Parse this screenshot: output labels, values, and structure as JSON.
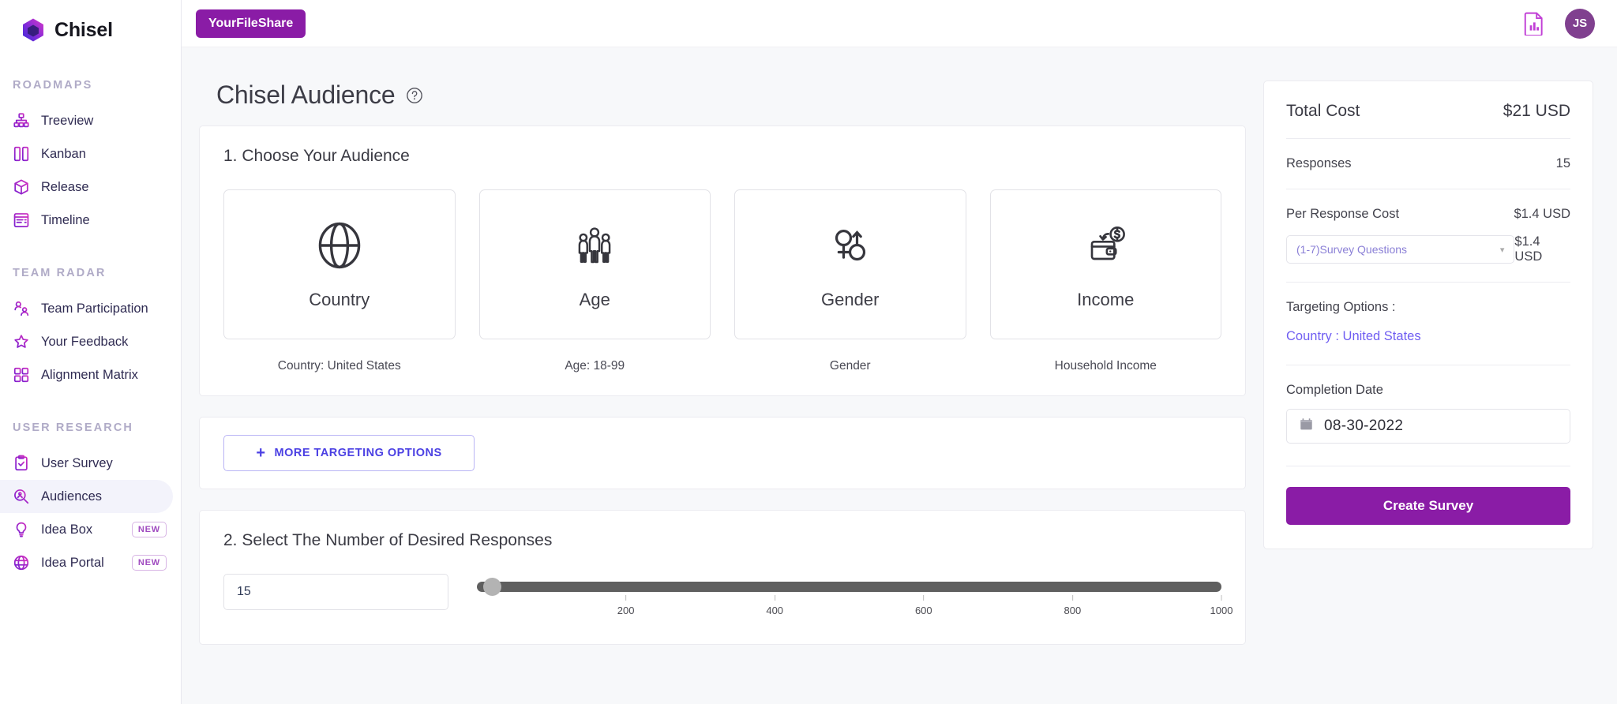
{
  "brand": {
    "name": "Chisel",
    "logo_icon": "chisel-hexagon-logo"
  },
  "sidebar": {
    "sections": [
      {
        "title": "ROADMAPS",
        "items": [
          {
            "label": "Treeview",
            "icon": "treeview-icon",
            "active": false,
            "badge": ""
          },
          {
            "label": "Kanban",
            "icon": "kanban-icon",
            "active": false,
            "badge": ""
          },
          {
            "label": "Release",
            "icon": "release-cube-icon",
            "active": false,
            "badge": ""
          },
          {
            "label": "Timeline",
            "icon": "timeline-icon",
            "active": false,
            "badge": ""
          }
        ]
      },
      {
        "title": "TEAM RADAR",
        "items": [
          {
            "label": "Team Participation",
            "icon": "team-participation-icon",
            "active": false,
            "badge": ""
          },
          {
            "label": "Your Feedback",
            "icon": "star-icon",
            "active": false,
            "badge": ""
          },
          {
            "label": "Alignment Matrix",
            "icon": "alignment-matrix-icon",
            "active": false,
            "badge": ""
          }
        ]
      },
      {
        "title": "USER RESEARCH",
        "items": [
          {
            "label": "User Survey",
            "icon": "clipboard-check-icon",
            "active": false,
            "badge": ""
          },
          {
            "label": "Audiences",
            "icon": "audience-search-icon",
            "active": true,
            "badge": ""
          },
          {
            "label": "Idea Box",
            "icon": "lightbulb-icon",
            "active": false,
            "badge": "NEW"
          },
          {
            "label": "Idea Portal",
            "icon": "globe-icon",
            "active": false,
            "badge": "NEW"
          }
        ]
      }
    ]
  },
  "topbar": {
    "file_chip": "YourFileShare",
    "report_icon": "report-document-icon",
    "avatar_initials": "JS"
  },
  "page": {
    "title": "Chisel Audience",
    "help_icon": "question-circle-icon"
  },
  "audience_section": {
    "title": "1. Choose Your Audience",
    "tiles": [
      {
        "label": "Country",
        "icon": "globe-icon",
        "sub": "Country: United States"
      },
      {
        "label": "Age",
        "icon": "people-group-icon",
        "sub": "Age: 18-99"
      },
      {
        "label": "Gender",
        "icon": "gender-symbols-icon",
        "sub": "Gender"
      },
      {
        "label": "Income",
        "icon": "wallet-dollar-icon",
        "sub": "Household Income"
      }
    ],
    "more_button": "MORE TARGETING OPTIONS",
    "more_button_icon": "plus-icon"
  },
  "responses_section": {
    "title": "2. Select The Number of Desired Responses",
    "input_value": "15",
    "input_placeholder": "15",
    "slider": {
      "min": 0,
      "max": 1000,
      "value": 15,
      "ticks": [
        200,
        400,
        600,
        800,
        1000
      ]
    }
  },
  "cost_panel": {
    "total_cost_label": "Total Cost",
    "total_cost_value": "$21 USD",
    "responses_label": "Responses",
    "responses_value": "15",
    "per_response_label": "Per Response Cost",
    "per_response_value": "$1.4 USD",
    "questions_select": "(1-7)Survey Questions",
    "questions_price": "$1.4 USD",
    "targeting_title": "Targeting Options :",
    "targeting_value": "Country : United States",
    "completion_label": "Completion Date",
    "completion_date": "08-30-2022",
    "calendar_icon": "calendar-icon",
    "create_button": "Create Survey"
  },
  "colors": {
    "brand_purple": "#8a1ca6",
    "accent_indigo": "#4b40e3",
    "link_purple": "#6f5df2",
    "sidebar_icon": "#a02ad0",
    "page_bg": "#f7f8fa"
  }
}
